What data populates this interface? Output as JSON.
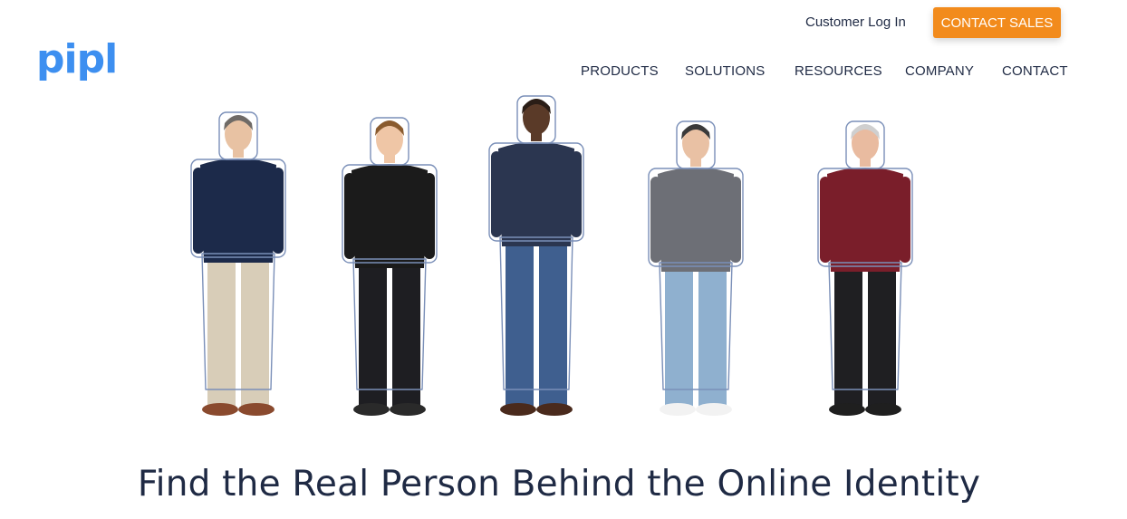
{
  "header": {
    "logo": "pipl",
    "login_link": "Customer Log In",
    "cta_button": "CONTACT SALES"
  },
  "nav": {
    "items": [
      "PRODUCTS",
      "SOLUTIONS",
      "RESOURCES",
      "COMPANY",
      "CONTACT"
    ]
  },
  "hero": {
    "headline": "Find the Real Person Behind the Online Identity",
    "people": [
      {
        "hair": "#6f6a66",
        "skin": "#e8c2a3",
        "top": "#1c2a4a",
        "pants": "#d8cdb8",
        "shoes": "#8a4a2e"
      },
      {
        "hair": "#8a5b2e",
        "skin": "#efc6a6",
        "top": "#1b1b1b",
        "pants": "#1e1e22",
        "shoes": "#2a2a2a"
      },
      {
        "hair": "#2a1d16",
        "skin": "#5a3a28",
        "top": "#2b3650",
        "pants": "#3f5f8f",
        "shoes": "#4a2a1c"
      },
      {
        "hair": "#3a3a3a",
        "skin": "#e9c1a4",
        "top": "#6d6f76",
        "pants": "#8fb0cf",
        "shoes": "#f2f2f2"
      },
      {
        "hair": "#cfcfcf",
        "skin": "#e9bba0",
        "top": "#7a1e2a",
        "pants": "#1f1f22",
        "shoes": "#1f1f1f"
      }
    ],
    "outline_color": "#7a8fb8"
  }
}
